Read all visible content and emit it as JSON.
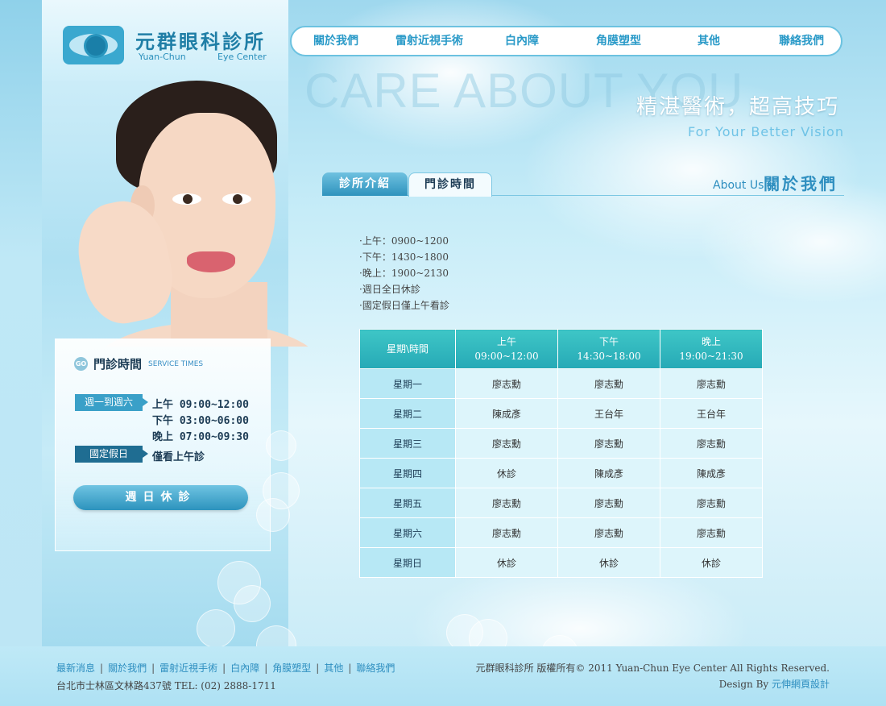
{
  "logo": {
    "title": "元群眼科診所",
    "en_left": "Yuan-Chun",
    "en_right": "Eye Center"
  },
  "nav": [
    "關於我們",
    "雷射近視手術",
    "白內障",
    "角膜塑型",
    "其他",
    "聯絡我們"
  ],
  "hero": {
    "bg_text": "CARE ABOUT YOU",
    "headline": "精湛醫術，超高技巧",
    "subline": "For Your Better Vision"
  },
  "tabs": {
    "intro": "診所介紹",
    "hours": "門診時間",
    "section_en": "About Us",
    "section_cn": "關於我們"
  },
  "service_panel": {
    "badge": "GO",
    "title": "門診時間",
    "subtitle": "SERVICE TIMES",
    "weekday_tag": "週一到週六",
    "lines": [
      "上午 09:00~12:00",
      "下午 03:00~06:00",
      "晚上 07:00~09:30"
    ],
    "holiday_tag": "國定假日",
    "holiday_text": "僅看上午診",
    "closed_button": "週日休診"
  },
  "hours_list": [
    "·上午：0900~1200",
    "·下午：1430~1800",
    "·晚上：1900~2130",
    "·週日全日休診",
    "·國定假日僅上午看診"
  ],
  "schedule": {
    "headers": [
      {
        "line1": "星期\\時間",
        "line2": ""
      },
      {
        "line1": "上午",
        "line2": "09:00~12:00"
      },
      {
        "line1": "下午",
        "line2": "14:30~18:00"
      },
      {
        "line1": "晚上",
        "line2": "19:00~21:30"
      }
    ],
    "rows": [
      {
        "day": "星期一",
        "am": "廖志勳",
        "pm": "廖志勳",
        "eve": "廖志勳"
      },
      {
        "day": "星期二",
        "am": "陳成彥",
        "pm": "王台年",
        "eve": "王台年"
      },
      {
        "day": "星期三",
        "am": "廖志勳",
        "pm": "廖志勳",
        "eve": "廖志勳"
      },
      {
        "day": "星期四",
        "am": "休診",
        "pm": "陳成彥",
        "eve": "陳成彥"
      },
      {
        "day": "星期五",
        "am": "廖志勳",
        "pm": "廖志勳",
        "eve": "廖志勳"
      },
      {
        "day": "星期六",
        "am": "廖志勳",
        "pm": "廖志勳",
        "eve": "廖志勳"
      },
      {
        "day": "星期日",
        "am": "休診",
        "pm": "休診",
        "eve": "休診"
      }
    ]
  },
  "footer": {
    "links": [
      "最新消息",
      "關於我們",
      "雷射近視手術",
      "白內障",
      "角膜塑型",
      "其他",
      "聯絡我們"
    ],
    "separator": "|",
    "address": "台北市士林區文林路437號 TEL: (02) 2888-1711",
    "copyright": "元群眼科診所 版權所有© 2011 Yuan-Chun Eye Center All Rights Reserved.",
    "design_prefix": "Design By ",
    "design_link": "元伸網頁設計"
  },
  "colors": {
    "accent": "#2a9ac8",
    "table_header": "#26a9b6",
    "dark_tag": "#1f6d92"
  }
}
